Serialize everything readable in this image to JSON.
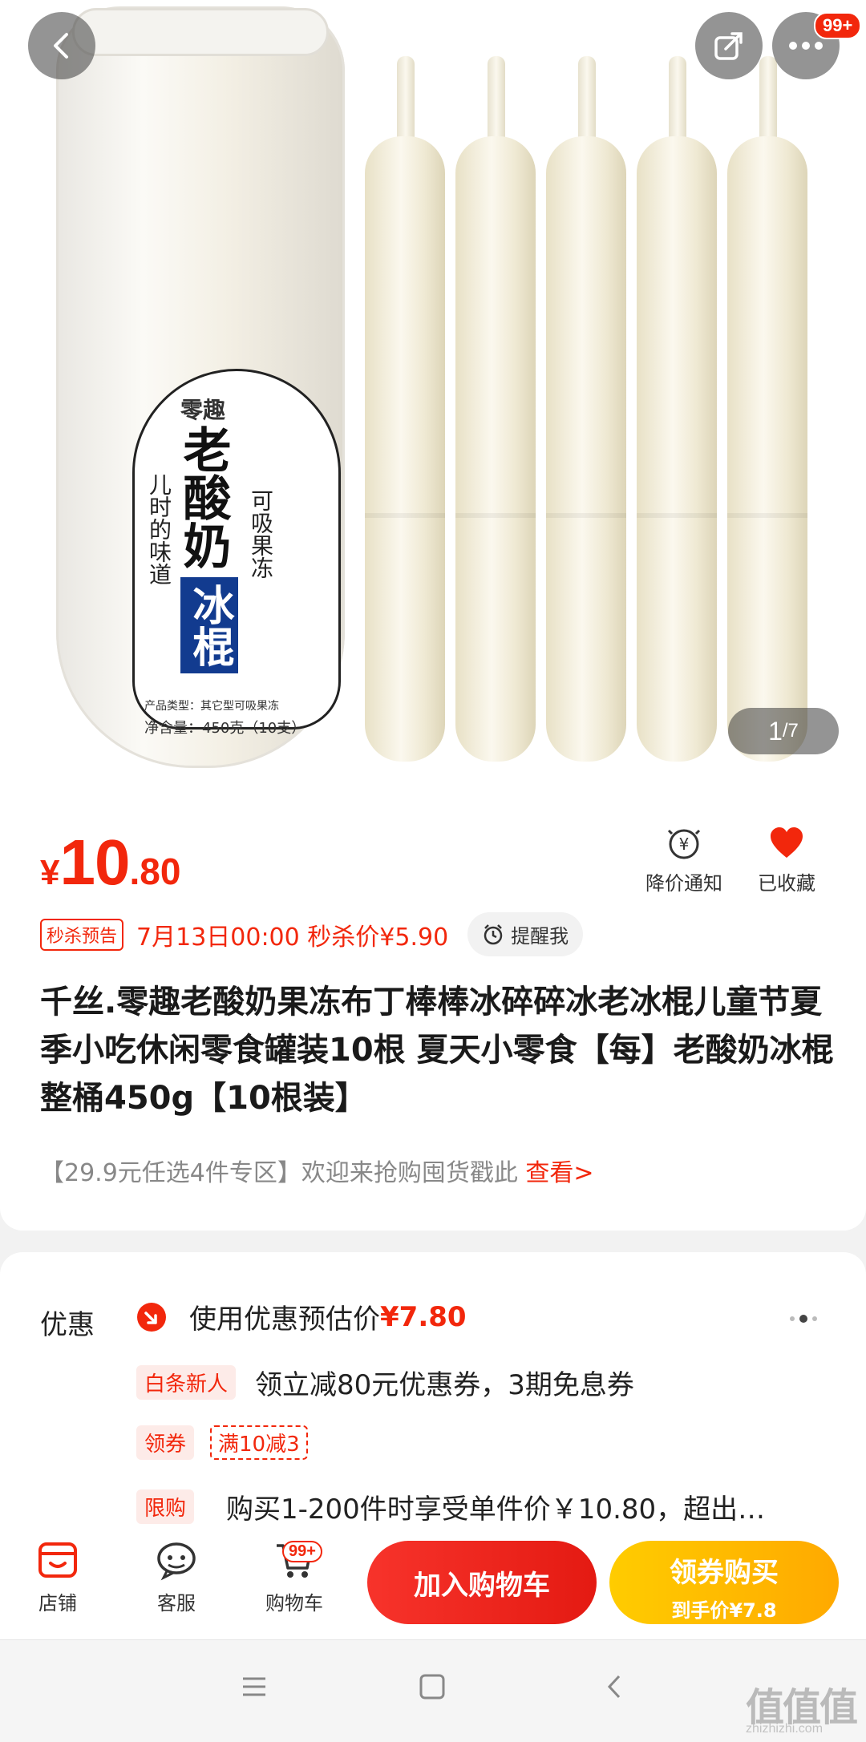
{
  "hero": {
    "page_current": "1",
    "page_total": "/7",
    "more_badge": "99+",
    "product_label": {
      "brand": "零趣",
      "name": "老酸奶",
      "name_highlight": "冰棍",
      "side_left": "儿时的味道",
      "side_right": "可吸果冻",
      "type_line": "产品类型：其它型可吸果冻",
      "net_line": "净含量：450克（10支）"
    }
  },
  "price": {
    "currency": "¥",
    "integer": "10",
    "decimal": ".80"
  },
  "actions": {
    "price_alert": "降价通知",
    "favorited": "已收藏"
  },
  "flash_sale": {
    "tag": "秒杀预告",
    "text": "7月13日00:00 秒杀价¥5.90",
    "remind": "提醒我"
  },
  "product": {
    "title": "千丝.零趣老酸奶果冻布丁棒棒冰碎碎冰老冰棍儿童节夏季小吃休闲零食罐装10根 夏天小零食【每】老酸奶冰棍整桶450g【10根装】"
  },
  "promo": {
    "text": "【29.9元任选4件专区】欢迎来抢购囤货戳此 ",
    "link": "查看>"
  },
  "discounts": {
    "label": "优惠",
    "estimate": "使用优惠预估价",
    "estimate_price": "¥7.80",
    "baitiao_tag": "白条新人",
    "baitiao_text": "领立减80元优惠券，3期免息券",
    "coupon_tag": "领券",
    "coupon_value": "满10减3",
    "limit_tag": "限购",
    "limit_text": "购买1-200件时享受单件价￥10.80，超出…"
  },
  "bottom_bar": {
    "shop": "店铺",
    "service": "客服",
    "cart": "购物车",
    "cart_badge": "99+",
    "add_to_cart": "加入购物车",
    "buy_now": "领券购买",
    "buy_now_sub": "到手价¥7.8"
  },
  "watermark": {
    "main": "值值值",
    "sub": "zhizhizhi.com"
  },
  "colors": {
    "accent": "#f2270c",
    "buy_button": "#ffb300"
  }
}
